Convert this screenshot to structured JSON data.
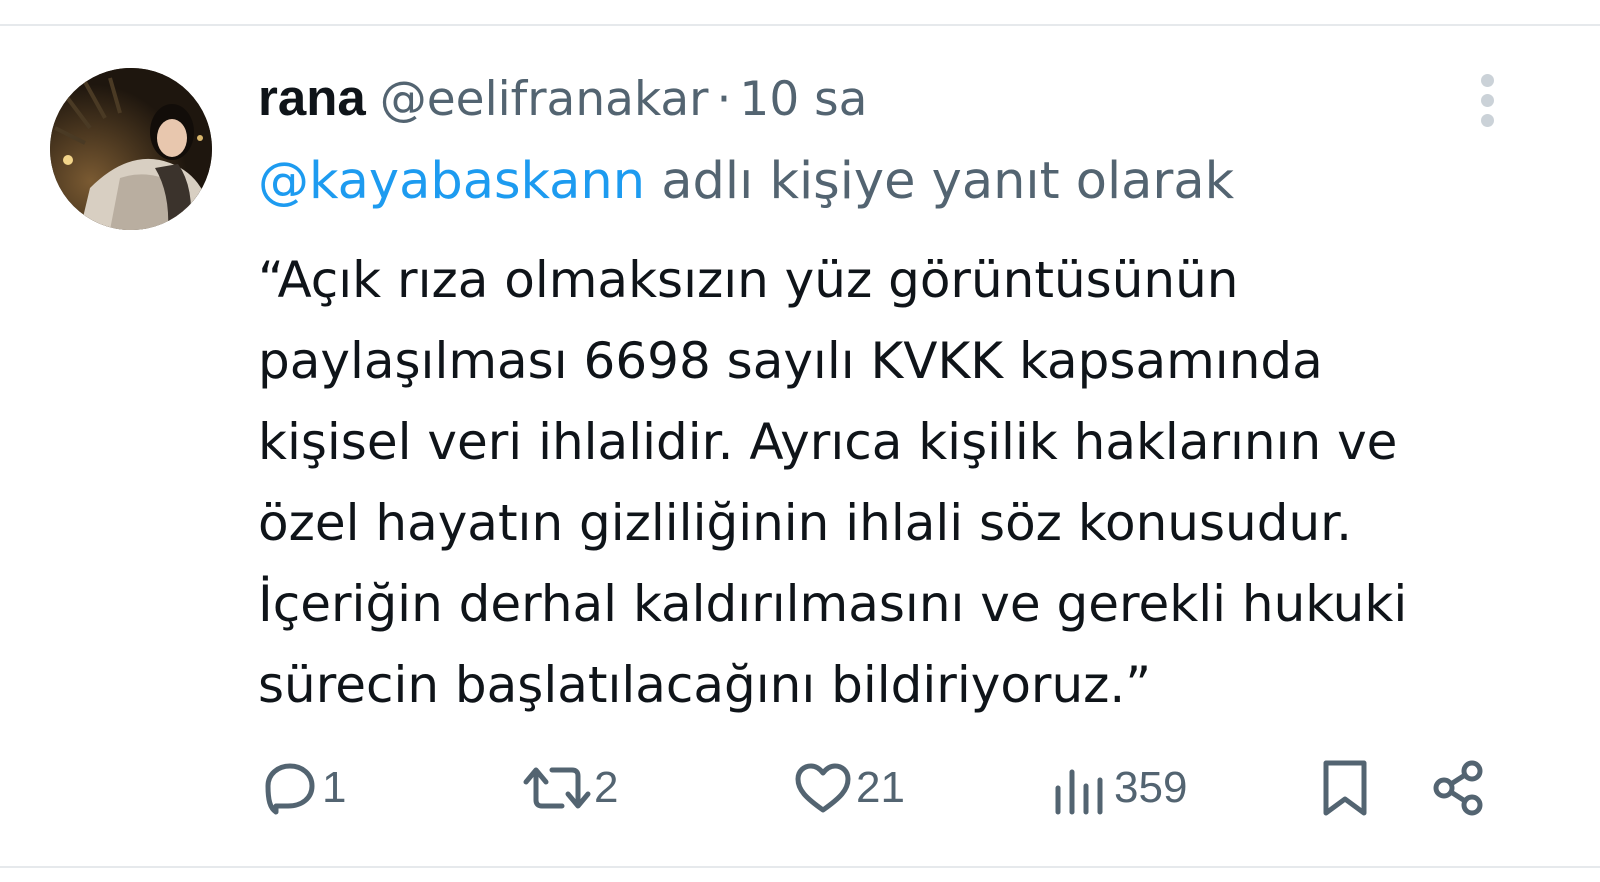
{
  "tweet": {
    "author": {
      "display_name": "rana",
      "handle": "@eelifranakar",
      "separator": "·",
      "time": "10 sa"
    },
    "reply_to": {
      "handle": "@kayabaskann",
      "suffix": " adlı kişiye yanıt olarak"
    },
    "text_lines": [
      "“Açık rıza olmaksızın yüz görüntüsünün",
      "paylaşılması 6698 sayılı KVKK kapsamında",
      "kişisel veri ihlalidir. Ayrıca kişilik haklarının ve",
      "özel hayatın gizliliğinin ihlali söz konusudur.",
      "İçeriğin derhal kaldırılmasını ve gerekli hukuki",
      "sürecin başlatılacağını bildiriyoruz.”"
    ],
    "actions": {
      "replies": "1",
      "reposts": "2",
      "likes": "21",
      "views": "359"
    }
  },
  "icons": {
    "more": "more-vertical-icon",
    "reply": "reply-icon",
    "repost": "repost-icon",
    "like": "heart-icon",
    "views": "views-icon",
    "bookmark": "bookmark-icon",
    "share": "share-icon"
  },
  "colors": {
    "text": "#0f1419",
    "secondary": "#536471",
    "link": "#1d9bf0",
    "divider": "#e6e9ec"
  }
}
